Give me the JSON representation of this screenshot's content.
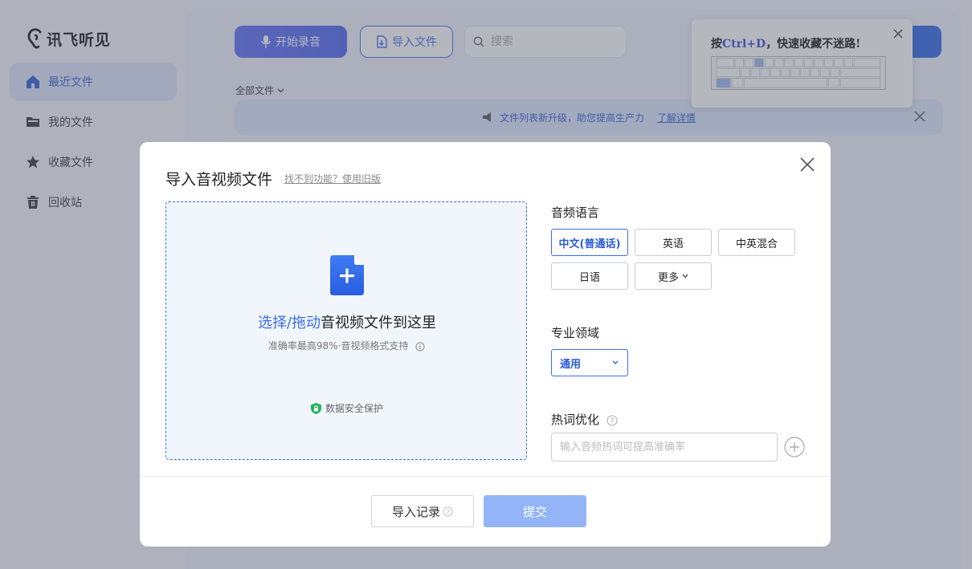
{
  "app": {
    "logo_text": "讯飞听见"
  },
  "sidebar": {
    "items": [
      {
        "label": "最近文件",
        "icon": "home-icon",
        "active": true
      },
      {
        "label": "我的文件",
        "icon": "folder-icon",
        "active": false
      },
      {
        "label": "收藏文件",
        "icon": "star-icon",
        "active": false
      },
      {
        "label": "回收站",
        "icon": "trash-icon",
        "active": false
      }
    ]
  },
  "toolbar": {
    "record_label": "开始录音",
    "import_label": "导入文件",
    "search_placeholder": "搜索",
    "filter_label": "全部文件"
  },
  "banner": {
    "text": "文件列表新升级，助您提高生产力",
    "link": "了解详情"
  },
  "tip": {
    "prefix": "按",
    "shortcut": "Ctrl+D",
    "suffix": "，快速收藏不迷路!"
  },
  "modal": {
    "title": "导入音视频文件",
    "old_version_link": "找不到功能？使用旧版",
    "drop_highlight": "选择/拖动",
    "drop_text": "音视频文件到这里",
    "drop_sub": "准确率最高98%·音视频格式支持",
    "secure_text": "数据安全保护",
    "language_label": "音频语言",
    "languages": [
      "中文(普通话)",
      "英语",
      "中英混合",
      "日语",
      "更多"
    ],
    "selected_language": "中文(普通话)",
    "domain_label": "专业领域",
    "domain_value": "通用",
    "hotword_label": "热词优化",
    "hotword_placeholder": "输入音频热词可提高准确率",
    "history_button": "导入记录",
    "submit_button": "提交"
  },
  "colors": {
    "accent": "#3b6de8",
    "record_button": "#5b6cf5",
    "submit_disabled": "#93b5f7",
    "secure_green": "#22b35e"
  }
}
